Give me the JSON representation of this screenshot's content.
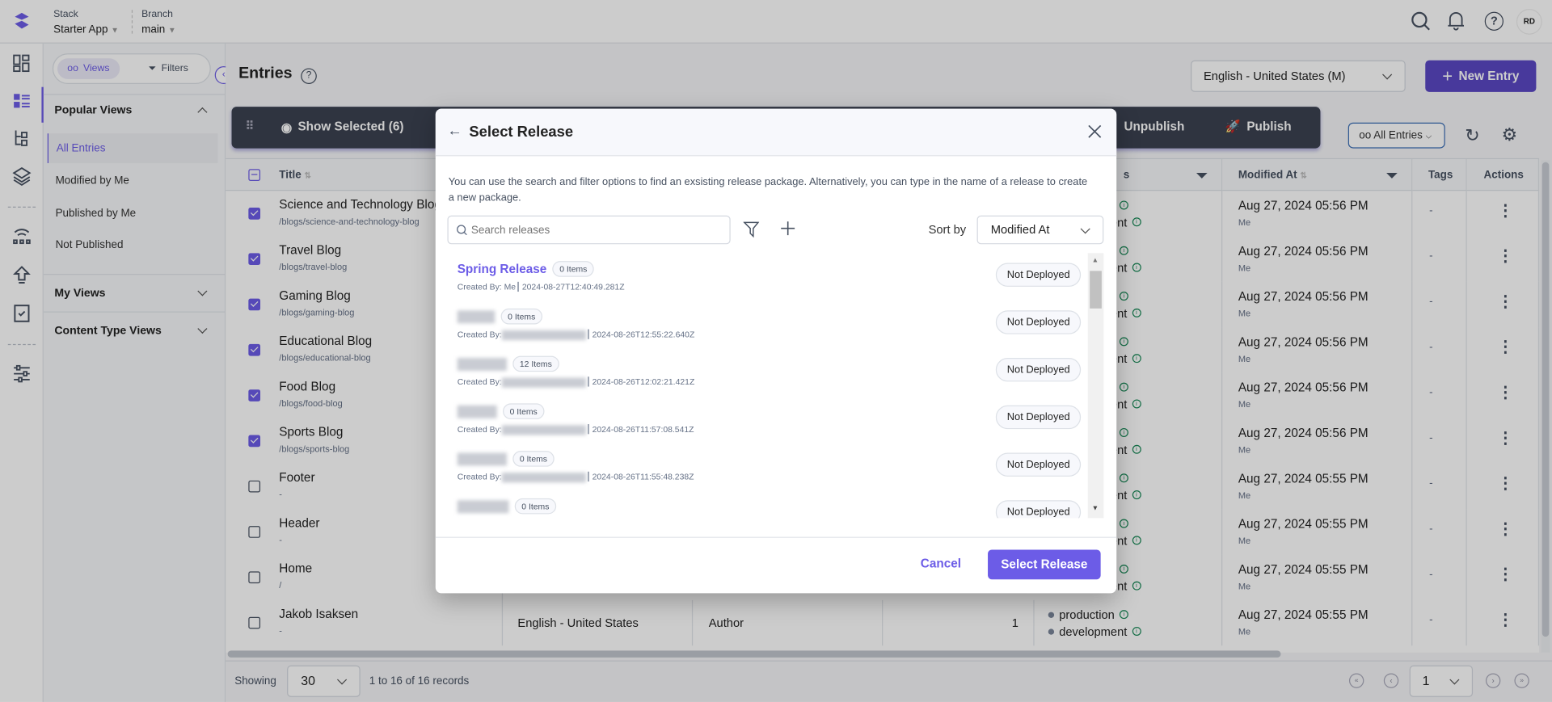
{
  "colors": {
    "accent": "#6c5ce7",
    "toolbar": "#3b4150",
    "success": "#1a8a58"
  },
  "topbar": {
    "stack_label": "Stack",
    "stack_value": "Starter App",
    "branch_label": "Branch",
    "branch_value": "main",
    "avatar": "RD",
    "icons": [
      "search-icon",
      "bell-icon",
      "help-icon"
    ]
  },
  "rail": {
    "icons": [
      "dashboard-icon",
      "entries-icon",
      "content-models-icon",
      "assets-icon",
      "releases-icon",
      "deploy-icon",
      "tasks-icon",
      "settings-sliders-icon"
    ]
  },
  "sidebar": {
    "views_tab": "Views",
    "filters_tab": "Filters",
    "popular_views": "Popular Views",
    "popular_items": [
      "All Entries",
      "Modified by Me",
      "Published by Me",
      "Not Published"
    ],
    "my_views": "My Views",
    "content_type_views": "Content Type Views"
  },
  "main": {
    "title": "Entries",
    "language": "English - United States (M)",
    "new_entry": "New Entry",
    "show_selected": "Show Selected (6)",
    "unpublish": "Unpublish",
    "publish": "Publish",
    "all_entries": "All Entries"
  },
  "table": {
    "columns": {
      "title": "Title",
      "publish_status": "s",
      "modified_at": "Modified At",
      "tags": "Tags",
      "actions": "Actions"
    },
    "rows": [
      {
        "title": "Science and Technology Blog",
        "url": "/blogs/science-and-technology-blog",
        "checked": true,
        "modified": "Aug 27, 2024 05:56 PM",
        "by": "Me",
        "tags": "-"
      },
      {
        "title": "Travel Blog",
        "url": "/blogs/travel-blog",
        "checked": true,
        "modified": "Aug 27, 2024 05:56 PM",
        "by": "Me",
        "tags": "-"
      },
      {
        "title": "Gaming Blog",
        "url": "/blogs/gaming-blog",
        "checked": true,
        "modified": "Aug 27, 2024 05:56 PM",
        "by": "Me",
        "tags": "-"
      },
      {
        "title": "Educational Blog",
        "url": "/blogs/educational-blog",
        "checked": true,
        "modified": "Aug 27, 2024 05:56 PM",
        "by": "Me",
        "tags": "-"
      },
      {
        "title": "Food Blog",
        "url": "/blogs/food-blog",
        "checked": true,
        "modified": "Aug 27, 2024 05:56 PM",
        "by": "Me",
        "tags": "-"
      },
      {
        "title": "Sports Blog",
        "url": "/blogs/sports-blog",
        "checked": true,
        "modified": "Aug 27, 2024 05:56 PM",
        "by": "Me",
        "tags": "-"
      },
      {
        "title": "Footer",
        "url": "-",
        "checked": false,
        "modified": "Aug 27, 2024 05:55 PM",
        "by": "Me",
        "tags": "-"
      },
      {
        "title": "Header",
        "url": "-",
        "checked": false,
        "modified": "Aug 27, 2024 05:55 PM",
        "by": "Me",
        "tags": "-"
      },
      {
        "title": "Home",
        "url": "/",
        "checked": false,
        "modified": "Aug 27, 2024 05:55 PM",
        "by": "Me",
        "tags": "-"
      },
      {
        "title": "Jakob Isaksen",
        "url": "-",
        "checked": false,
        "language": "English - United States",
        "content_type": "Author",
        "version": "1",
        "modified": "Aug 27, 2024 05:55 PM",
        "by": "Me",
        "tags": "-"
      }
    ],
    "environments": [
      "production",
      "development"
    ]
  },
  "footer": {
    "showing": "Showing",
    "per_page": "30",
    "records": "1 to 16 of 16 records",
    "page": "1"
  },
  "modal": {
    "title": "Select Release",
    "description": "You can use the search and filter options to find an exsisting release package. Alternatively, you can type in the name of a release to create a new package.",
    "search_placeholder": "Search releases",
    "sort_label": "Sort by",
    "sort_value": "Modified At",
    "releases": [
      {
        "name": "Spring Release",
        "items": "0 Items",
        "created_by": "Created By: Me",
        "date": "2024-08-27T12:40:49.281Z",
        "status": "Not Deployed"
      },
      {
        "items": "0 Items",
        "created_by": "Created By:",
        "date": "2024-08-26T12:55:22.640Z",
        "status": "Not Deployed"
      },
      {
        "items": "12 Items",
        "created_by": "Created By:",
        "date": "2024-08-26T12:02:21.421Z",
        "status": "Not Deployed"
      },
      {
        "items": "0 Items",
        "created_by": "Created By:",
        "date": "2024-08-26T11:57:08.541Z",
        "status": "Not Deployed"
      },
      {
        "items": "0 Items",
        "created_by": "Created By:",
        "date": "2024-08-26T11:55:48.238Z",
        "status": "Not Deployed"
      },
      {
        "items": "0 Items",
        "status": "Not Deployed"
      }
    ],
    "cancel": "Cancel",
    "confirm": "Select Release"
  }
}
